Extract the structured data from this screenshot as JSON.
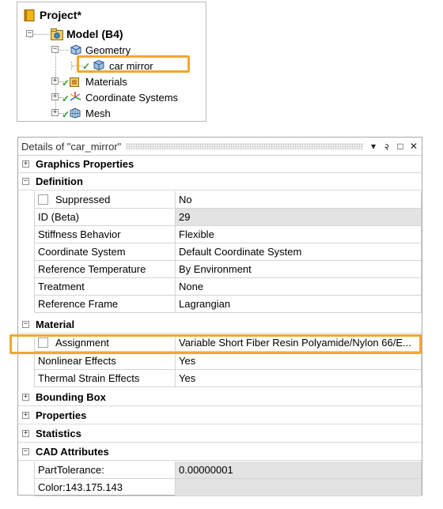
{
  "tree": {
    "project_label": "Project*",
    "model_label": "Model (B4)",
    "geometry_label": "Geometry",
    "part_label": "car mirror",
    "materials_label": "Materials",
    "coordinate_systems_label": "Coordinate Systems",
    "mesh_label": "Mesh"
  },
  "details": {
    "title": "Details of \"car_mirror\"",
    "pin_glyph": "▾",
    "pushpin_glyph": "२",
    "maximize_glyph": "□",
    "close_glyph": "✕",
    "groups": {
      "graphics": "Graphics Properties",
      "definition": "Definition",
      "material": "Material",
      "bounding_box": "Bounding Box",
      "properties": "Properties",
      "statistics": "Statistics",
      "cad_attributes": "CAD Attributes"
    },
    "rows": {
      "suppressed": {
        "label": "Suppressed",
        "value": "No"
      },
      "id": {
        "label": "ID (Beta)",
        "value": "29"
      },
      "stiffness": {
        "label": "Stiffness Behavior",
        "value": "Flexible"
      },
      "coord": {
        "label": "Coordinate System",
        "value": "Default Coordinate System"
      },
      "reftemp": {
        "label": "Reference Temperature",
        "value": "By Environment"
      },
      "treatment": {
        "label": "Treatment",
        "value": "None"
      },
      "refframe": {
        "label": "Reference Frame",
        "value": "Lagrangian"
      },
      "assignment": {
        "label": "Assignment",
        "value": "Variable Short Fiber Resin Polyamide/Nylon 66/E..."
      },
      "nonlinear": {
        "label": "Nonlinear Effects",
        "value": "Yes"
      },
      "thermal": {
        "label": "Thermal Strain Effects",
        "value": "Yes"
      },
      "parttol": {
        "label": "PartTolerance:",
        "value": "0.00000001"
      },
      "color": {
        "label": "Color:143.175.143",
        "value": ""
      }
    },
    "expanded_glyph": "−",
    "collapsed_glyph": "+"
  },
  "colors": {
    "highlight": "#f0a830",
    "readonly_bg": "#e3e3e3",
    "check": "#2e9e2e"
  }
}
